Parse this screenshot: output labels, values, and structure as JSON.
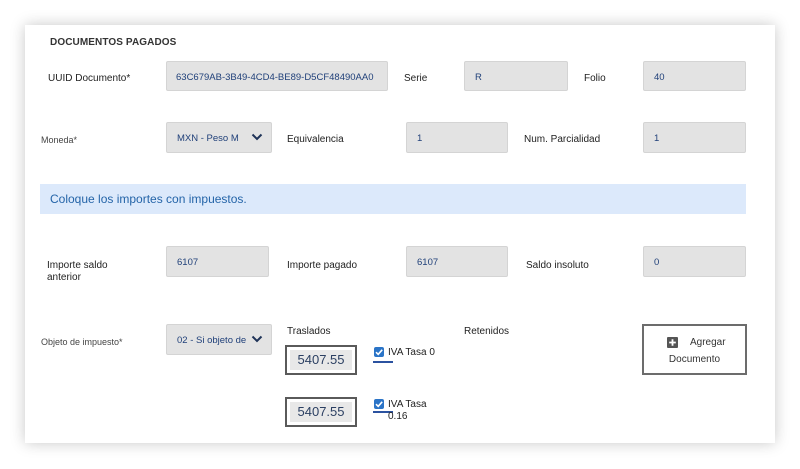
{
  "section": {
    "title": "DOCUMENTOS PAGADOS"
  },
  "row1": {
    "uuid_label": "UUID Documento*",
    "uuid_value": "63C679AB-3B49-4CD4-BE89-D5CF48490AA0",
    "serie_label": "Serie",
    "serie_value": "R",
    "folio_label": "Folio",
    "folio_value": "40"
  },
  "row2": {
    "moneda_label": "Moneda*",
    "moneda_selected": "MXN - Peso M",
    "equivalencia_label": "Equivalencia",
    "equivalencia_value": "1",
    "parcialidad_label": "Num. Parcialidad",
    "parcialidad_value": "1"
  },
  "info": {
    "message": "Coloque los importes con impuestos."
  },
  "row3": {
    "saldo_anterior_label_1": "Importe saldo",
    "saldo_anterior_label_2": "anterior",
    "saldo_anterior_value": "6107",
    "importe_pagado_label": "Importe pagado",
    "importe_pagado_value": "6107",
    "saldo_insoluto_label": "Saldo insoluto",
    "saldo_insoluto_value": "0"
  },
  "row4": {
    "objeto_label": "Objeto de impuesto*",
    "objeto_selected": "02 - Si objeto de",
    "traslados_label": "Traslados",
    "retenidos_label": "Retenidos",
    "traslados": [
      {
        "amount": "5407.55",
        "tax_label_1": "IVA Tasa 0",
        "tax_label_2": "",
        "checked": true
      },
      {
        "amount": "5407.55",
        "tax_label_1": "IVA Tasa",
        "tax_label_2": "0.16",
        "checked": true
      }
    ],
    "add_button_line1": "Agregar",
    "add_button_line2": "Documento"
  },
  "colors": {
    "accent": "#2b74c7",
    "info_bg": "#dce9fb",
    "info_text": "#2464a8",
    "field_bg": "#e3e3e3",
    "field_text": "#21417a"
  },
  "icons": {
    "select_arrow": "chevron-down-icon",
    "add": "plus-square-icon",
    "checkbox": "check-icon"
  }
}
